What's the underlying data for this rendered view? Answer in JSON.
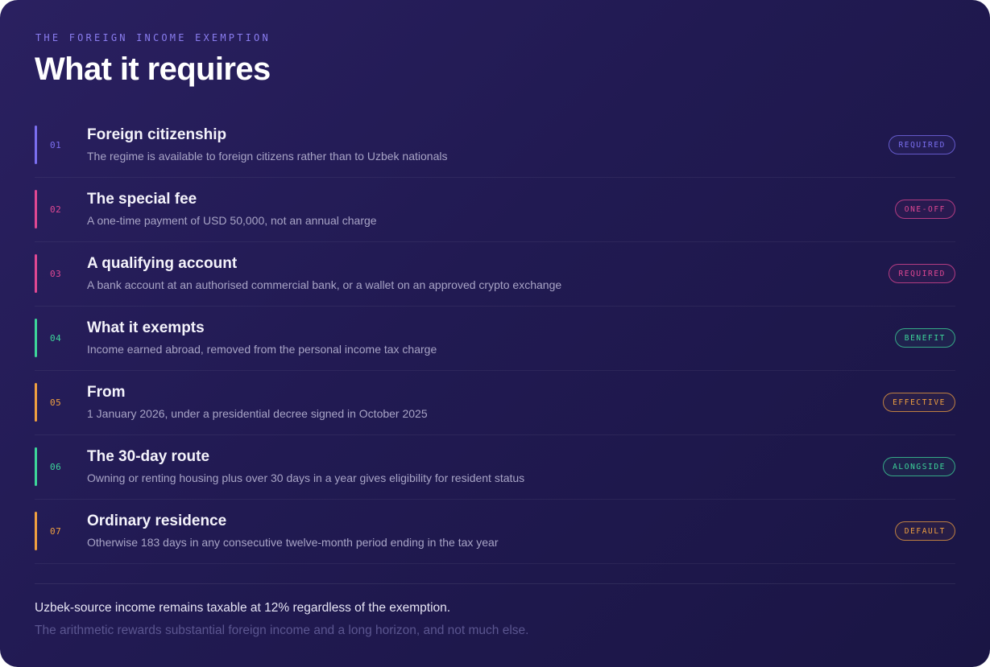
{
  "header": {
    "eyebrow": "THE FOREIGN INCOME EXEMPTION",
    "title": "What it requires"
  },
  "colors": {
    "violet": "#7b6ff0",
    "pink": "#e04893",
    "green": "#3dd69a",
    "orange": "#f0a040"
  },
  "rows": [
    {
      "num": "01",
      "title": "Foreign citizenship",
      "desc": "The regime is available to foreign citizens rather than to Uzbek nationals",
      "badge": "REQUIRED",
      "color": "#7b6ff0"
    },
    {
      "num": "02",
      "title": "The special fee",
      "desc": "A one-time payment of USD 50,000, not an annual charge",
      "badge": "ONE-OFF",
      "color": "#e04893"
    },
    {
      "num": "03",
      "title": "A qualifying account",
      "desc": "A bank account at an authorised commercial bank, or a wallet on an approved crypto exchange",
      "badge": "REQUIRED",
      "color": "#e04893"
    },
    {
      "num": "04",
      "title": "What it exempts",
      "desc": "Income earned abroad, removed from the personal income tax charge",
      "badge": "BENEFIT",
      "color": "#3dd69a"
    },
    {
      "num": "05",
      "title": "From",
      "desc": "1 January 2026, under a presidential decree signed in October 2025",
      "badge": "EFFECTIVE",
      "color": "#f0a040"
    },
    {
      "num": "06",
      "title": "The 30-day route",
      "desc": "Owning or renting housing plus over 30 days in a year gives eligibility for resident status",
      "badge": "ALONGSIDE",
      "color": "#3dd69a"
    },
    {
      "num": "07",
      "title": "Ordinary residence",
      "desc": "Otherwise 183 days in any consecutive twelve-month period ending in the tax year",
      "badge": "DEFAULT",
      "color": "#f0a040"
    }
  ],
  "footer": {
    "note": "Uzbek-source income remains taxable at 12% regardless of the exemption.",
    "subnote": "The arithmetic rewards substantial foreign income and a long horizon, and not much else."
  }
}
